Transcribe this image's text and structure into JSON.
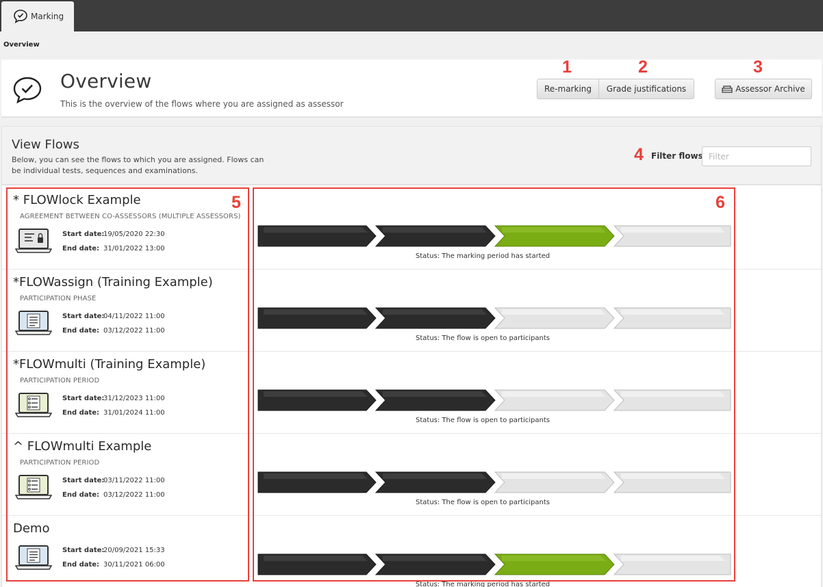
{
  "tab": {
    "label": "Marking",
    "icon": "check-speech-bubble-icon"
  },
  "breadcrumb": "Overview",
  "header": {
    "title": "Overview",
    "subtitle": "This is the overview of the flows where you are assigned as assessor",
    "icon": "check-speech-bubble-icon",
    "buttons": {
      "remarking": "Re-marking",
      "grade_justifications": "Grade justifications",
      "assessor_archive": "Assessor Archive"
    }
  },
  "view_flows": {
    "title": "View Flows",
    "description": "Below, you can see the flows to which you are assigned. Flows can be individual tests, sequences and examinations.",
    "filter_label": "Filter flows",
    "filter_placeholder": "Filter"
  },
  "colors": {
    "stage_done": "#2b2b2b",
    "stage_active": "#7aac14",
    "stage_pending": "#e4e4e4",
    "annotation": "#e8403a"
  },
  "flows": [
    {
      "name": "* FLOWlock Example",
      "phase": "AGREEMENT BETWEEN CO-ASSESSORS (MULTIPLE ASSESSORS)",
      "start_label": "Start date:",
      "start": "19/05/2020 22:30",
      "end_label": "End date:",
      "end": "31/01/2022 13:00",
      "icon": "laptop-lock-icon",
      "stages": [
        "done",
        "done",
        "active",
        "pending"
      ],
      "status": "Status: The marking period has started"
    },
    {
      "name": "*FLOWassign (Training Example)",
      "phase": "PARTICIPATION PHASE",
      "start_label": "Start date:",
      "start": "04/11/2022 11:00",
      "end_label": "End date:",
      "end": "03/12/2022 11:00",
      "icon": "laptop-document-icon",
      "stages": [
        "done",
        "done",
        "pending",
        "pending"
      ],
      "status": "Status: The flow is open to participants"
    },
    {
      "name": "*FLOWmulti (Training Example)",
      "phase": "PARTICIPATION PERIOD",
      "start_label": "Start date:",
      "start": "31/12/2023 11:00",
      "end_label": "End date:",
      "end": "31/01/2024 11:00",
      "icon": "laptop-checklist-icon",
      "stages": [
        "done",
        "done",
        "pending",
        "pending"
      ],
      "status": "Status: The flow is open to participants"
    },
    {
      "name": "^ FLOWmulti Example",
      "phase": "PARTICIPATION PERIOD",
      "start_label": "Start date:",
      "start": "03/11/2022 11:00",
      "end_label": "End date:",
      "end": "03/12/2022 11:00",
      "icon": "laptop-checklist-icon",
      "stages": [
        "done",
        "done",
        "pending",
        "pending"
      ],
      "status": "Status: The flow is open to participants"
    },
    {
      "name": "Demo",
      "phase": "",
      "start_label": "Start date:",
      "start": "20/09/2021 15:33",
      "end_label": "End date:",
      "end": "30/11/2021 06:00",
      "icon": "laptop-document-icon",
      "stages": [
        "done",
        "done",
        "active",
        "pending"
      ],
      "status": "Status: The marking period has started"
    }
  ],
  "annotations": [
    "1",
    "2",
    "3",
    "4",
    "5",
    "6"
  ]
}
